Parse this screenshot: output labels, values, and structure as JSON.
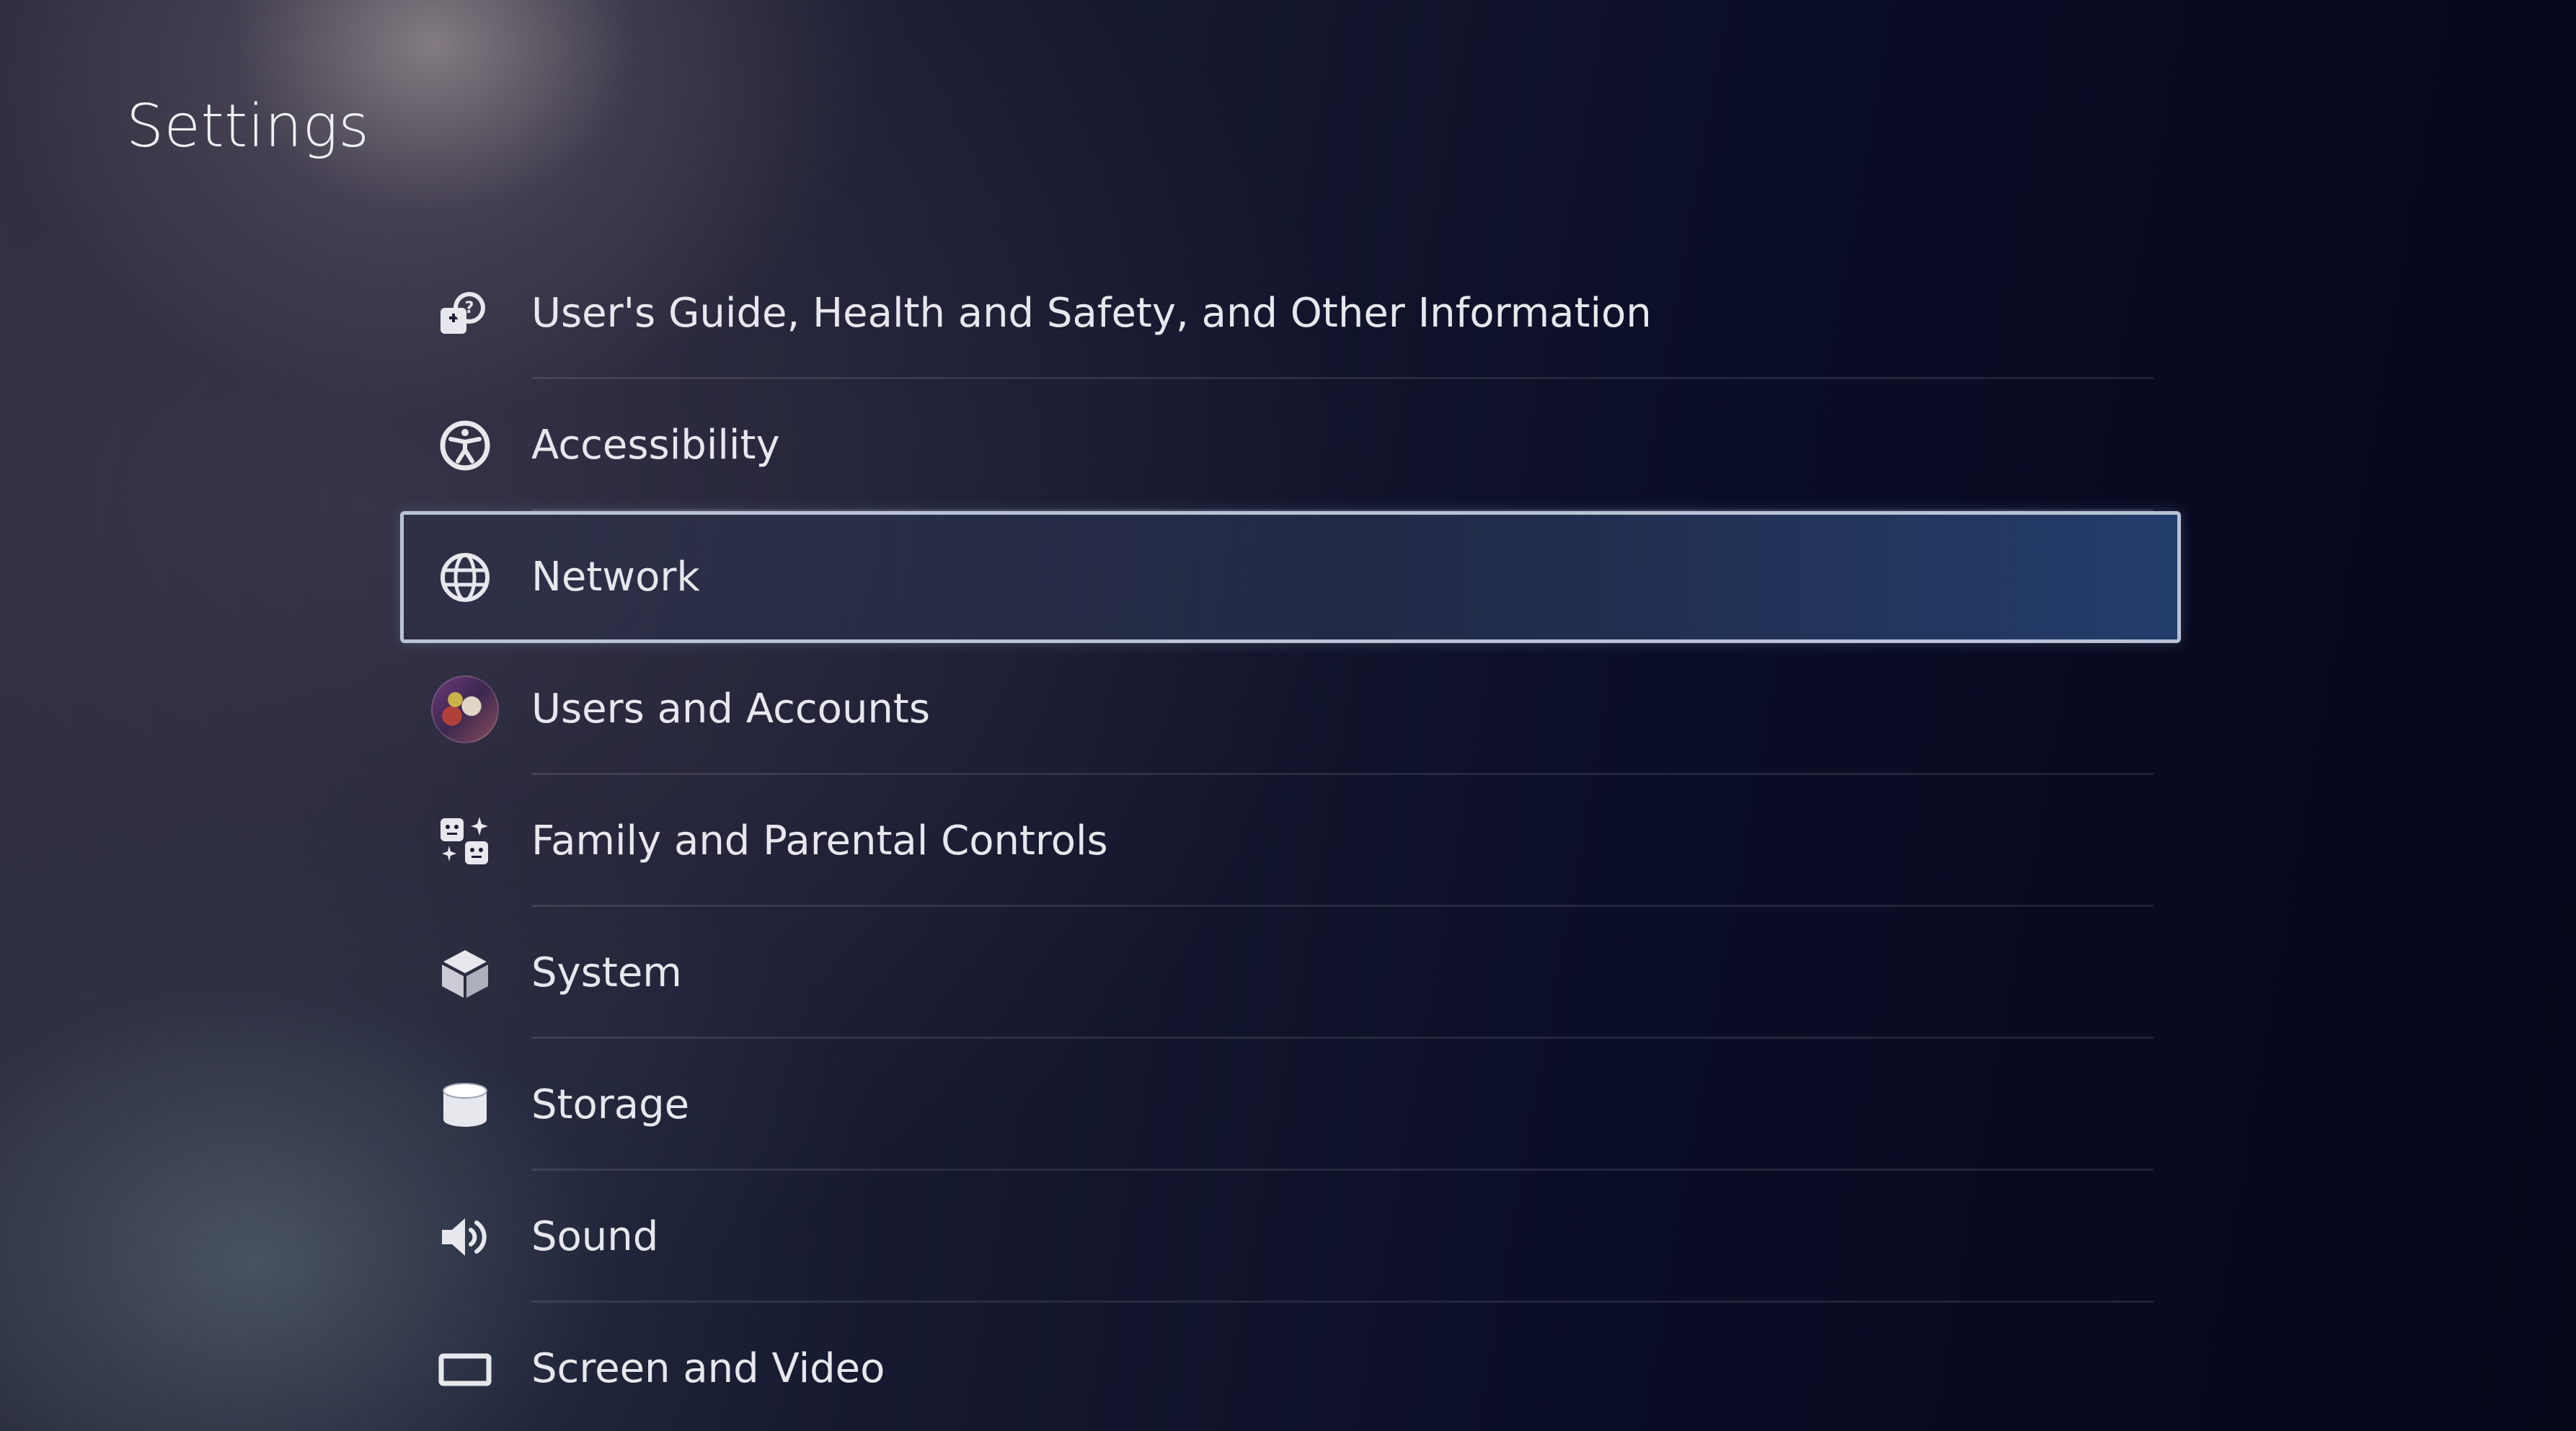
{
  "page": {
    "title": "Settings"
  },
  "colors": {
    "focus_border": "#b9c3d6",
    "text": "#e6e8ee",
    "background": "#0a0c1f"
  },
  "menu": {
    "items": [
      {
        "label": "User's Guide, Health and Safety, and Other Information",
        "icon": "info-guide-icon"
      },
      {
        "label": "Accessibility",
        "icon": "accessibility-icon"
      },
      {
        "label": "Network",
        "icon": "globe-icon",
        "selected": true
      },
      {
        "label": "Users and Accounts",
        "icon": "user-avatar"
      },
      {
        "label": "Family and Parental Controls",
        "icon": "family-icon"
      },
      {
        "label": "System",
        "icon": "cube-icon"
      },
      {
        "label": "Storage",
        "icon": "storage-icon"
      },
      {
        "label": "Sound",
        "icon": "speaker-icon"
      },
      {
        "label": "Screen and Video",
        "icon": "screen-icon"
      }
    ]
  }
}
